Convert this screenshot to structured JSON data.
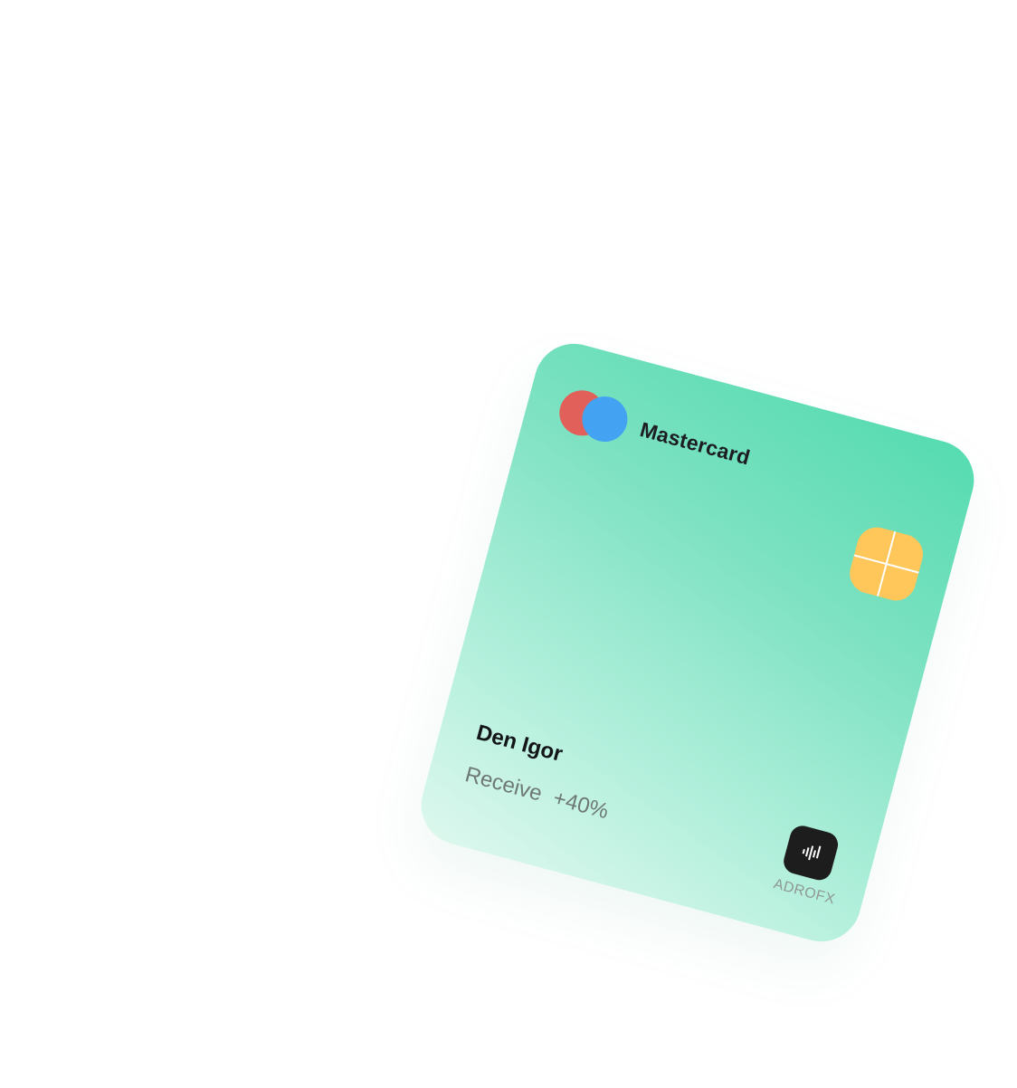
{
  "card": {
    "brand_label": "Mastercard",
    "owner_name": "Den Igor",
    "receive_label": "Receive",
    "receive_value": "+40%",
    "issuer_label": "ADROFX",
    "icons": {
      "brand_logo": "mastercard-logo-icon",
      "chip": "card-chip-icon",
      "issuer_logo": "adrofx-logo-icon"
    },
    "colors": {
      "gradient_top": "#55dbb0",
      "gradient_bottom": "#def8ee",
      "logo_red": "#e2605a",
      "logo_blue": "#44a2f2",
      "chip": "#ffc659",
      "issuer_badge": "#1d1d1d"
    }
  }
}
